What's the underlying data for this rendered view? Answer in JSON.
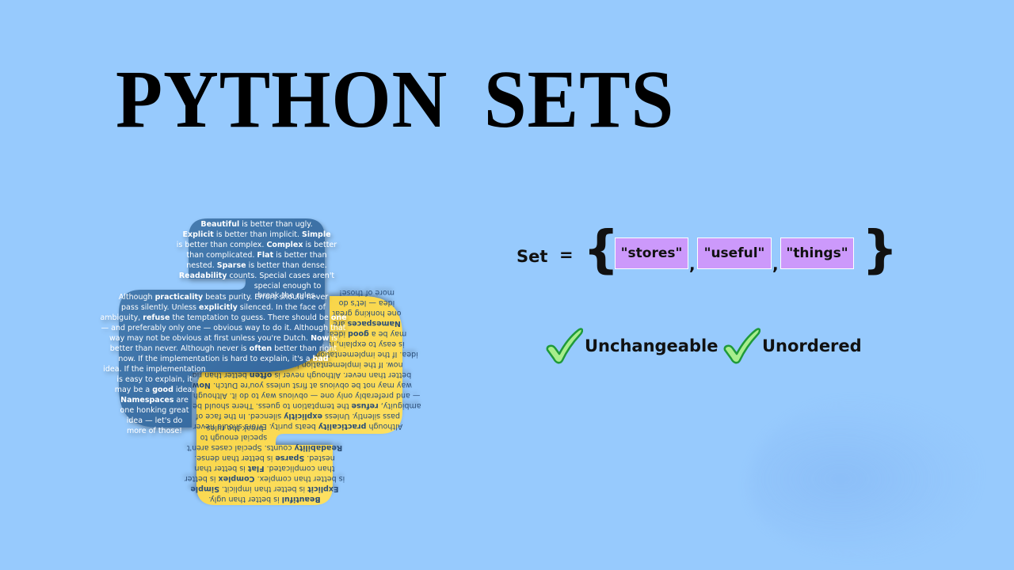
{
  "title": "PYTHON  SETS",
  "set_expression": {
    "name": "Set",
    "operator": "=",
    "open_brace": "{",
    "close_brace": "}",
    "elements": [
      "\"stores\"",
      "\"useful\"",
      "\"things\""
    ],
    "separator": ","
  },
  "properties": [
    {
      "label": "Unchangeable",
      "icon": "check-icon"
    },
    {
      "label": "Unordered",
      "icon": "check-icon"
    }
  ],
  "logo": {
    "description": "Python logo filled with The Zen of Python text",
    "colors": {
      "blue": "#3a6fa3",
      "yellow": "#fbd84a",
      "text_blue_half": "#ffffff",
      "text_yellow_half": "#2b4e78"
    },
    "lines": [
      "Beautiful is better than ugly.",
      "Explicit is better than implicit. Simple",
      "is better than complex. Complex is better",
      "than complicated. Flat is better than",
      "nested. Sparse is better than dense.",
      "Readability counts. Special cases aren't",
      "special enough to",
      "break the rules.",
      "Although practicality beats purity. Errors should never",
      "pass silently. Unless explicitly silenced. In the face of",
      "ambiguity, refuse the temptation to guess. There should be one",
      "— and preferably only one — obvious way to do it. Although that",
      "way may not be obvious at first unless you're Dutch. Now is",
      "better than never. Although never is often better than right",
      "now. If the implementation is hard to explain, it's a bad",
      "idea. If the implementation",
      "is easy to explain, it",
      "may be a good idea.",
      "Namespaces are",
      "one honking great",
      "idea — let's do",
      "more of those!"
    ]
  },
  "colors": {
    "background": "#97cafd",
    "element_box": "#cc99fb",
    "check_fill": "#a8ee8c",
    "check_stroke": "#1f9a3a"
  }
}
